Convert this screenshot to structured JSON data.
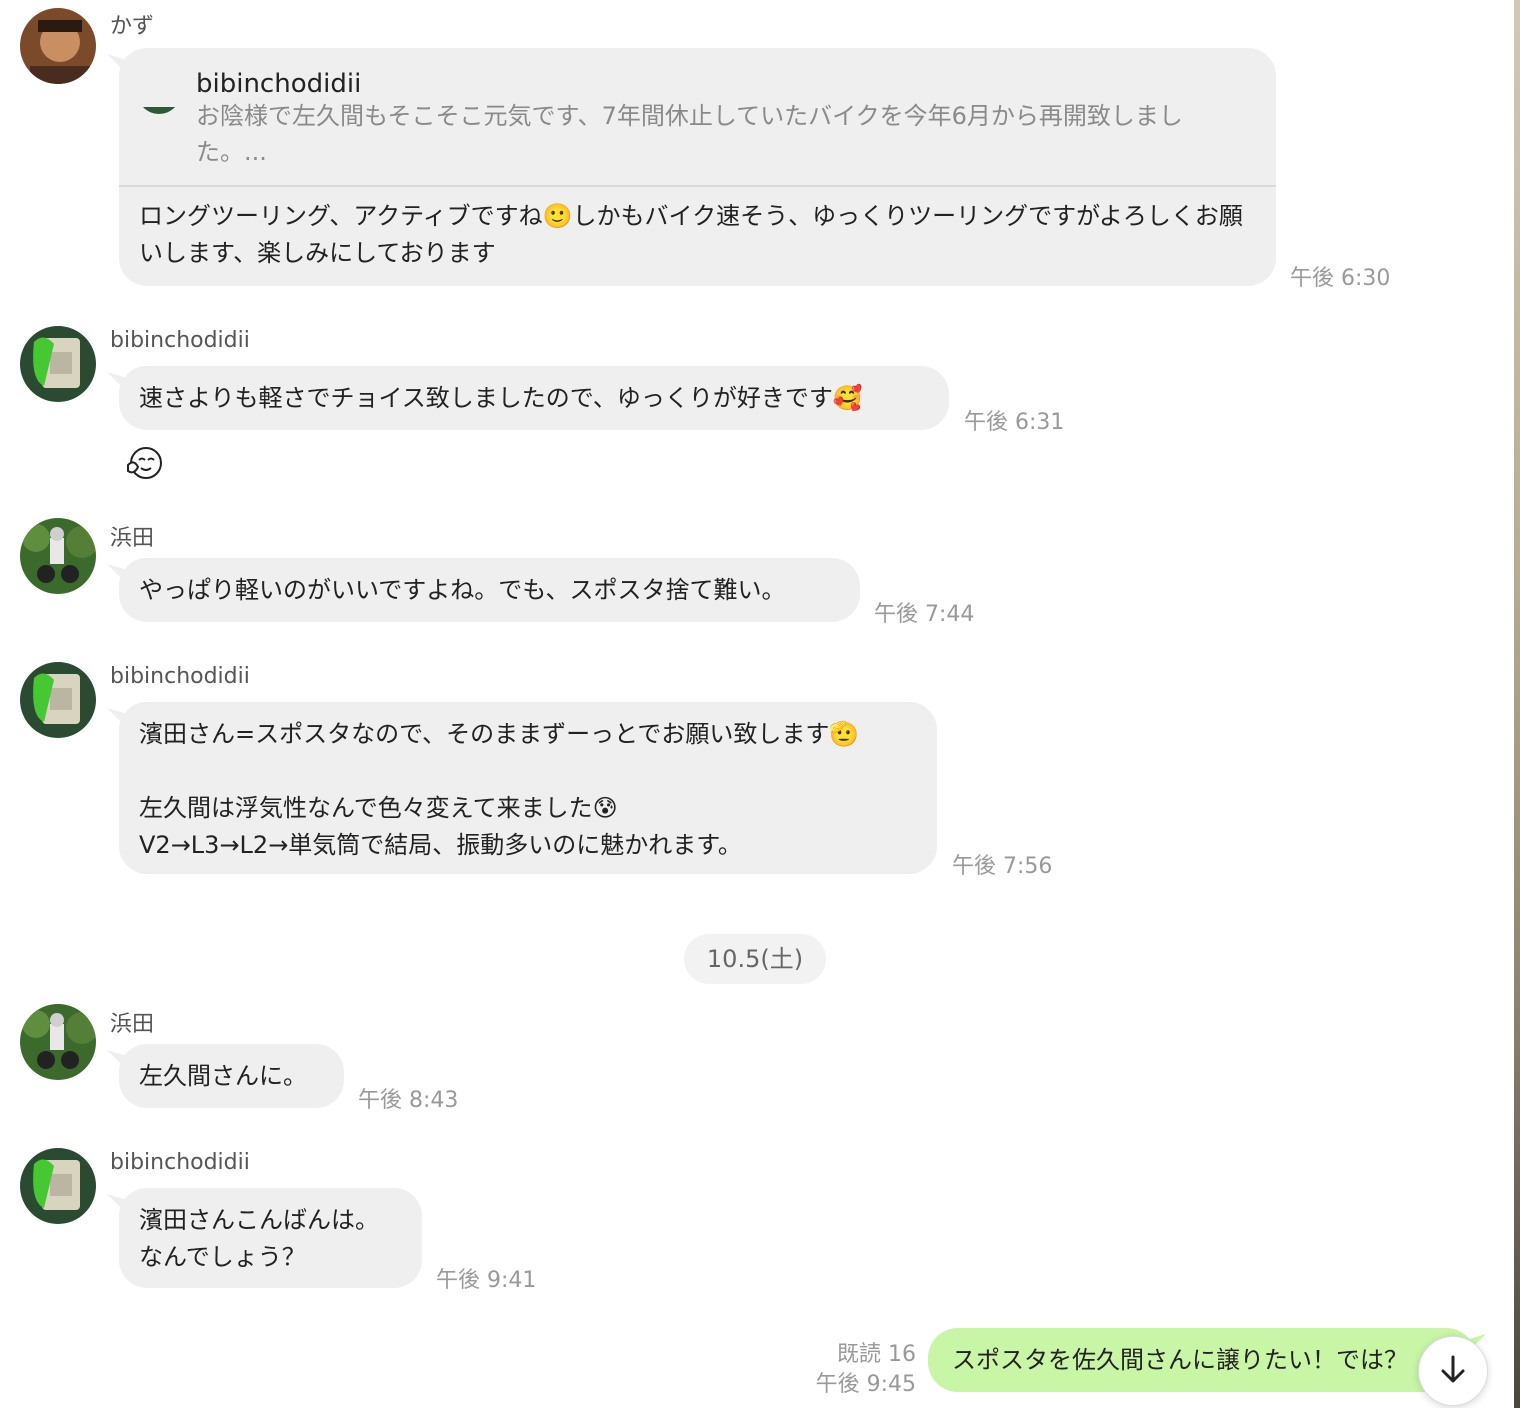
{
  "messages": [
    {
      "sender": "かず",
      "reply": {
        "name": "bibinchodidii",
        "text": "お陰様で左久間もそこそこ元気です、7年間休止していたバイクを今年6月から再開致しました。..."
      },
      "text": "ロングツーリング、アクティブですね🙂しかもバイク速そう、ゆっくりツーリングですがよろしくお願いします、楽しみにしております",
      "time": "午後 6:30"
    },
    {
      "sender": "bibinchodidii",
      "text": "速さよりも軽さでチョイス致しましたので、ゆっくりが好きです🥰",
      "time": "午後 6:31",
      "reaction_icon": "hands-on-cheeks-face-reaction"
    },
    {
      "sender": "浜田",
      "text": "やっぱり軽いのがいいですよね。でも、スポスタ捨て難い。",
      "time": "午後 7:44"
    },
    {
      "sender": "bibinchodidii",
      "text": "濱田さん=スポスタなので、そのままずーっとでお願い致します🫡\n\n左久間は浮気性なんで色々変えて来ました😰\nV2→L3→L2→単気筒で結局、振動多いのに魅かれます。",
      "time": "午後 7:56"
    },
    {
      "sender": "浜田",
      "text": "左久間さんに。",
      "time": "午後 8:43"
    },
    {
      "sender": "bibinchodidii",
      "text": "濱田さんこんばんは。\nなんでしょう？",
      "time": "午後 9:41"
    }
  ],
  "date_separator": "10.5(土)",
  "own_message": {
    "text": "スポスタを佐久間さんに譲りたい！では？",
    "read_label": "既読 16",
    "time": "午後 9:45"
  },
  "scroll_button_icon": "arrow-down-icon",
  "colors": {
    "incoming_bubble": "#efefef",
    "outgoing_bubble": "#c8f5a6",
    "timestamp": "#999999"
  }
}
